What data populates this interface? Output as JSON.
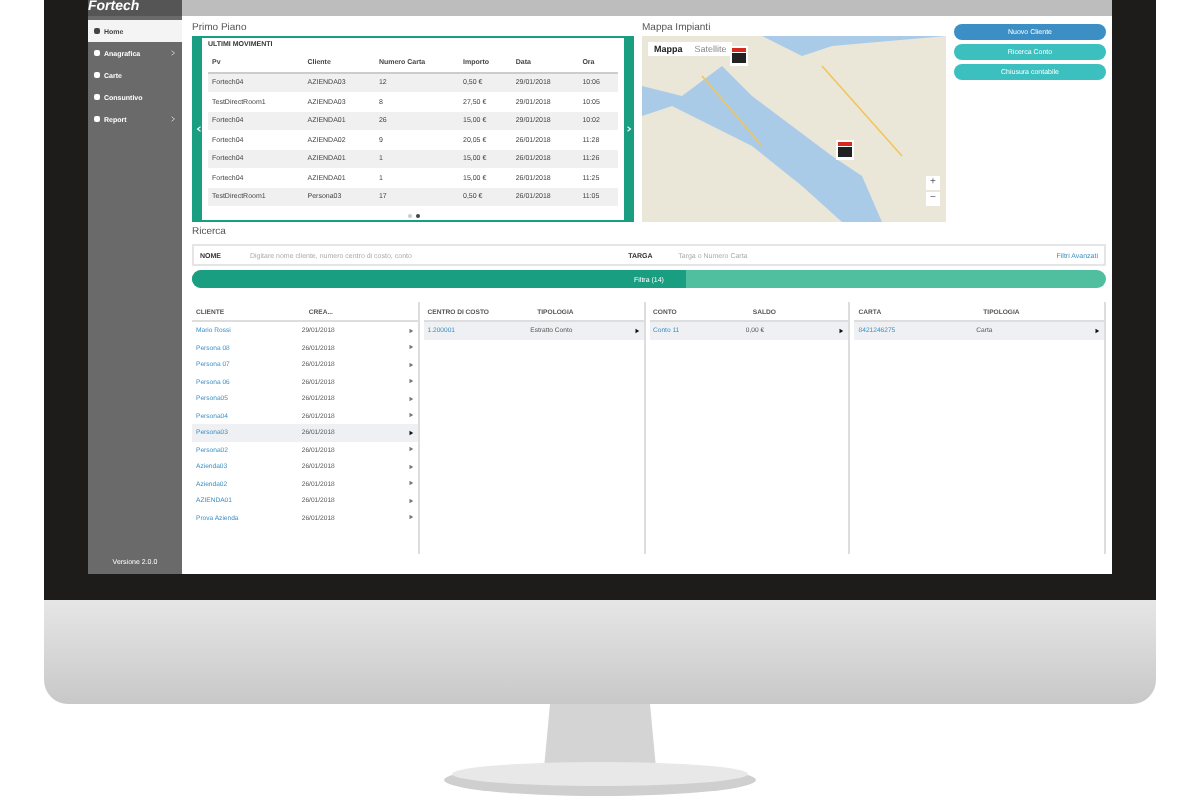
{
  "header": {
    "logo": "Fortech"
  },
  "sidebar": {
    "items": [
      {
        "label": "Home",
        "selected": true,
        "expandable": false
      },
      {
        "label": "Anagrafica",
        "selected": false,
        "expandable": true
      },
      {
        "label": "Carte",
        "selected": false,
        "expandable": false
      },
      {
        "label": "Consuntivo",
        "selected": false,
        "expandable": false
      },
      {
        "label": "Report",
        "selected": false,
        "expandable": true
      }
    ],
    "version": "Versione 2.0.0"
  },
  "primo_piano": {
    "title": "Primo Piano",
    "table_title": "ULTIMI MOVIMENTI",
    "columns": [
      "Pv",
      "Cliente",
      "Numero Carta",
      "Importo",
      "Data",
      "Ora"
    ],
    "rows": [
      [
        "Fortech04",
        "AZIENDA03",
        "12",
        "0,50 €",
        "29/01/2018",
        "10:06"
      ],
      [
        "TestDirectRoom1",
        "AZIENDA03",
        "8",
        "27,50 €",
        "29/01/2018",
        "10:05"
      ],
      [
        "Fortech04",
        "AZIENDA01",
        "26",
        "15,00 €",
        "29/01/2018",
        "10:02"
      ],
      [
        "Fortech04",
        "AZIENDA02",
        "9",
        "20,05 €",
        "26/01/2018",
        "11:28"
      ],
      [
        "Fortech04",
        "AZIENDA01",
        "1",
        "15,00 €",
        "26/01/2018",
        "11:26"
      ],
      [
        "Fortech04",
        "AZIENDA01",
        "1",
        "15,00 €",
        "26/01/2018",
        "11:25"
      ],
      [
        "TestDirectRoom1",
        "Persona03",
        "17",
        "0,50 €",
        "26/01/2018",
        "11:05"
      ]
    ],
    "pages": [
      {
        "selected": false
      },
      {
        "selected": true
      }
    ]
  },
  "map": {
    "title": "Mappa Impianti",
    "tabs": [
      {
        "label": "Mappa",
        "selected": true
      },
      {
        "label": "Satellite",
        "selected": false
      }
    ],
    "zoom_in": "+",
    "zoom_out": "−"
  },
  "actions": [
    {
      "label": "Nuovo Cliente",
      "kind": "primary"
    },
    {
      "label": "Ricerca Conto",
      "kind": "secondary"
    },
    {
      "label": "Chiusura contabile",
      "kind": "secondary"
    }
  ],
  "search": {
    "title": "Ricerca",
    "fields": [
      {
        "label": "NOME",
        "placeholder": "Digitare nome cliente, numero centro di costo, conto"
      },
      {
        "label": "TARGA",
        "placeholder": "Targa o Numero Carta"
      }
    ],
    "advanced_link": "Filtri Avanzati",
    "filter_button": {
      "label": "Filtra (14)",
      "level": 0.54
    }
  },
  "panes": [
    {
      "columns": [
        "CLIENTE",
        "CREA..."
      ],
      "rows": [
        {
          "name": "Mario Rossi",
          "date": "29/01/2018",
          "selected": false
        },
        {
          "name": "Persona 08",
          "date": "26/01/2018",
          "selected": false
        },
        {
          "name": "Persona 07",
          "date": "26/01/2018",
          "selected": false
        },
        {
          "name": "Persona 06",
          "date": "26/01/2018",
          "selected": false
        },
        {
          "name": "Persona05",
          "date": "26/01/2018",
          "selected": false
        },
        {
          "name": "Persona04",
          "date": "26/01/2018",
          "selected": false
        },
        {
          "name": "Persona03",
          "date": "26/01/2018",
          "selected": true
        },
        {
          "name": "Persona02",
          "date": "26/01/2018",
          "selected": false
        },
        {
          "name": "Azienda03",
          "date": "26/01/2018",
          "selected": false
        },
        {
          "name": "Azienda02",
          "date": "26/01/2018",
          "selected": false
        },
        {
          "name": "AZIENDA01",
          "date": "26/01/2018",
          "selected": false
        },
        {
          "name": "Prova Azienda",
          "date": "26/01/2018",
          "selected": false
        }
      ]
    },
    {
      "columns": [
        "CENTRO DI COSTO",
        "TIPOLOGIA"
      ],
      "rows": [
        {
          "name": "1.200001",
          "date": "Estratto Conto",
          "selected": true
        }
      ]
    },
    {
      "columns": [
        "CONTO",
        "SALDO"
      ],
      "rows": [
        {
          "name": "Conto 11",
          "date": "0,00 €",
          "selected": true
        }
      ]
    },
    {
      "columns": [
        "CARTA",
        "TIPOLOGIA"
      ],
      "rows": [
        {
          "name": "8421246275",
          "date": "Carta",
          "selected": true
        }
      ]
    }
  ]
}
